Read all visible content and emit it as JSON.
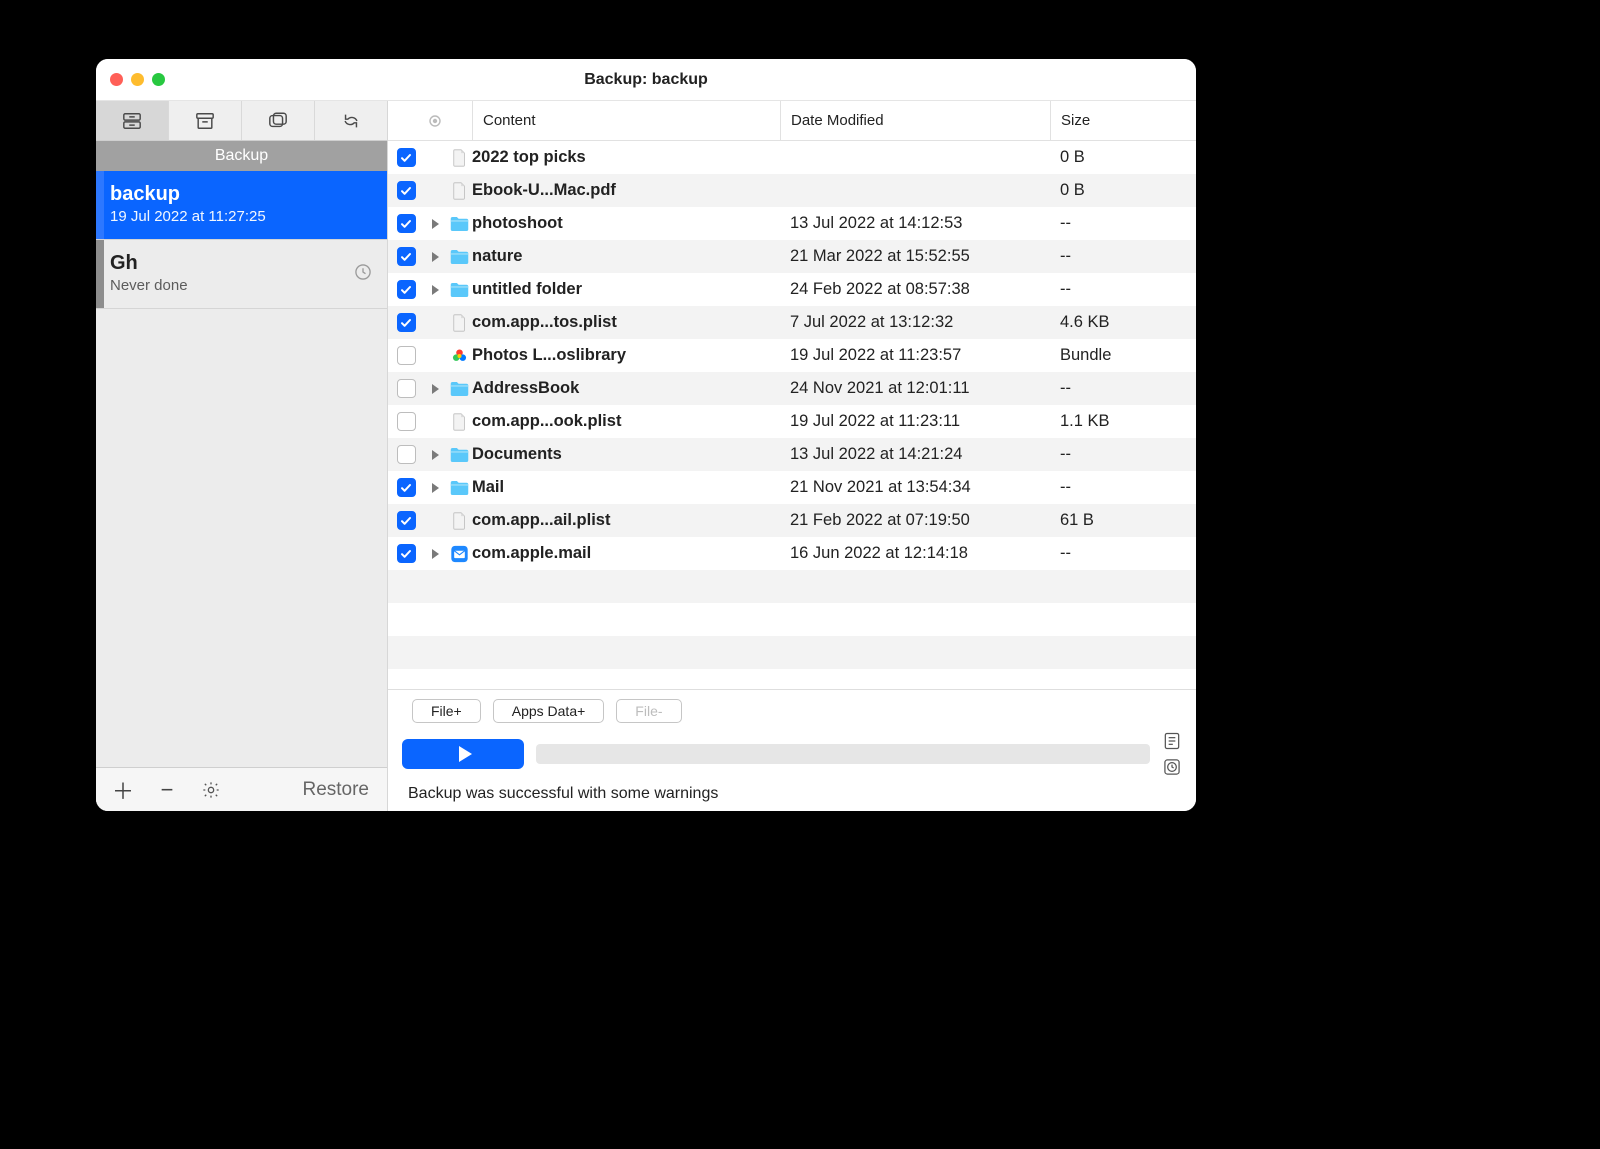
{
  "window_title": "Backup: backup",
  "sidebar": {
    "section_label": "Backup",
    "items": [
      {
        "name": "backup",
        "subtitle": "19 Jul 2022 at 11:27:25",
        "selected": true,
        "show_clock": false
      },
      {
        "name": "Gh",
        "subtitle": "Never done",
        "selected": false,
        "show_clock": true
      }
    ],
    "footer": {
      "restore_label": "Restore"
    }
  },
  "table": {
    "head_content": "Content",
    "head_date": "Date Modified",
    "head_size": "Size",
    "rows": [
      {
        "checked": true,
        "disclosure": false,
        "icon": "file",
        "name": "2022 top picks",
        "date": "",
        "size": "0 B"
      },
      {
        "checked": true,
        "disclosure": false,
        "icon": "file",
        "name": "Ebook-U...Mac.pdf",
        "date": "",
        "size": "0 B"
      },
      {
        "checked": true,
        "disclosure": true,
        "icon": "folder",
        "name": "photoshoot",
        "date": "13 Jul 2022 at 14:12:53",
        "size": "--"
      },
      {
        "checked": true,
        "disclosure": true,
        "icon": "folder",
        "name": "nature",
        "date": "21 Mar 2022 at 15:52:55",
        "size": "--"
      },
      {
        "checked": true,
        "disclosure": true,
        "icon": "folder",
        "name": "untitled folder",
        "date": "24 Feb 2022 at 08:57:38",
        "size": "--"
      },
      {
        "checked": true,
        "disclosure": false,
        "icon": "file",
        "name": "com.app...tos.plist",
        "date": "7 Jul 2022 at 13:12:32",
        "size": "4.6 KB"
      },
      {
        "checked": false,
        "disclosure": false,
        "icon": "photos",
        "name": "Photos L...oslibrary",
        "date": "19 Jul 2022 at 11:23:57",
        "size": "Bundle"
      },
      {
        "checked": false,
        "disclosure": true,
        "icon": "folder",
        "name": "AddressBook",
        "date": "24 Nov 2021 at 12:01:11",
        "size": "--"
      },
      {
        "checked": false,
        "disclosure": false,
        "icon": "file",
        "name": "com.app...ook.plist",
        "date": "19 Jul 2022 at 11:23:11",
        "size": "1.1 KB"
      },
      {
        "checked": false,
        "disclosure": true,
        "icon": "folder",
        "name": "Documents",
        "date": "13 Jul 2022 at 14:21:24",
        "size": "--"
      },
      {
        "checked": true,
        "disclosure": true,
        "icon": "folder",
        "name": "Mail",
        "date": "21 Nov 2021 at 13:54:34",
        "size": "--"
      },
      {
        "checked": true,
        "disclosure": false,
        "icon": "file",
        "name": "com.app...ail.plist",
        "date": "21 Feb 2022 at 07:19:50",
        "size": "61 B"
      },
      {
        "checked": true,
        "disclosure": true,
        "icon": "mail",
        "name": "com.apple.mail",
        "date": "16 Jun 2022 at 12:14:18",
        "size": "--"
      }
    ]
  },
  "toolbar": {
    "file_plus": "File+",
    "apps_data": "Apps Data+",
    "file_minus": "File-",
    "status": "Backup was successful with some warnings"
  }
}
